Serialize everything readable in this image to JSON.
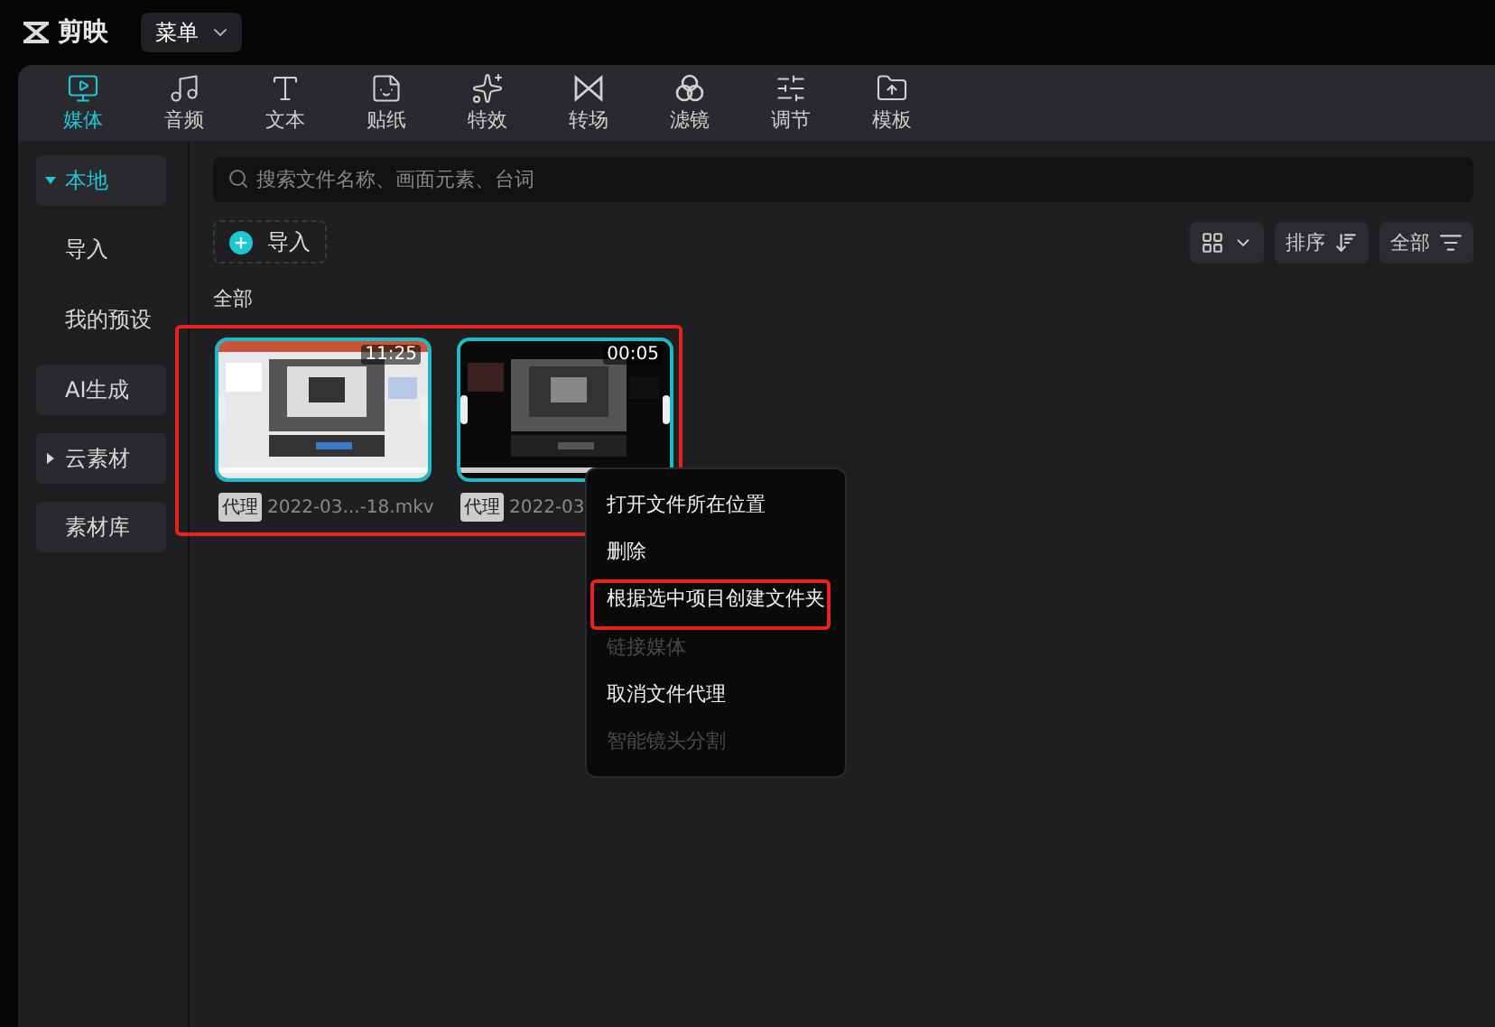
{
  "app": {
    "logo_text": "剪映",
    "menu_button": "菜单"
  },
  "tabs": [
    {
      "label": "媒体",
      "kind": "media",
      "selected": true
    },
    {
      "label": "音频",
      "kind": "audio",
      "selected": false
    },
    {
      "label": "文本",
      "kind": "text",
      "selected": false
    },
    {
      "label": "贴纸",
      "kind": "sticker",
      "selected": false
    },
    {
      "label": "特效",
      "kind": "effect",
      "selected": false
    },
    {
      "label": "转场",
      "kind": "transition",
      "selected": false
    },
    {
      "label": "滤镜",
      "kind": "filter",
      "selected": false
    },
    {
      "label": "调节",
      "kind": "adjust",
      "selected": false
    },
    {
      "label": "模板",
      "kind": "template",
      "selected": false
    }
  ],
  "sidebar": {
    "items": [
      {
        "label": "本地",
        "kind": "group",
        "expanded": true,
        "selected": true
      },
      {
        "label": "导入",
        "kind": "sub",
        "selected": false
      },
      {
        "label": "我的预设",
        "kind": "sub",
        "selected": false
      },
      {
        "label": "AI生成",
        "kind": "group",
        "selected": false
      },
      {
        "label": "云素材",
        "kind": "group",
        "expanded": false,
        "selected": false
      },
      {
        "label": "素材库",
        "kind": "group",
        "selected": false
      }
    ]
  },
  "search": {
    "placeholder": "搜索文件名称、画面元素、台词"
  },
  "toolbar": {
    "import_button": "导入",
    "sort_button": "排序",
    "filter_button": "全部"
  },
  "section_title": "全部",
  "media_grid": {
    "annotated": true,
    "items": [
      {
        "duration": "11:25",
        "badge": "代理",
        "filename": "2022-03...-18.mkv",
        "selected": true,
        "kind": "light"
      },
      {
        "duration": "00:05",
        "badge": "代理",
        "filename": "2022-03",
        "selected": true,
        "kind": "dark"
      }
    ]
  },
  "context_menu": {
    "items": [
      {
        "label": "打开文件所在位置",
        "disabled": false,
        "annotated": false
      },
      {
        "label": "删除",
        "disabled": false,
        "annotated": false
      },
      {
        "label": "根据选中项目创建文件夹",
        "disabled": false,
        "annotated": true
      },
      {
        "label": "链接媒体",
        "disabled": true,
        "annotated": false
      },
      {
        "label": "取消文件代理",
        "disabled": false,
        "annotated": false
      },
      {
        "label": "智能镜头分割",
        "disabled": true,
        "annotated": false
      }
    ]
  }
}
